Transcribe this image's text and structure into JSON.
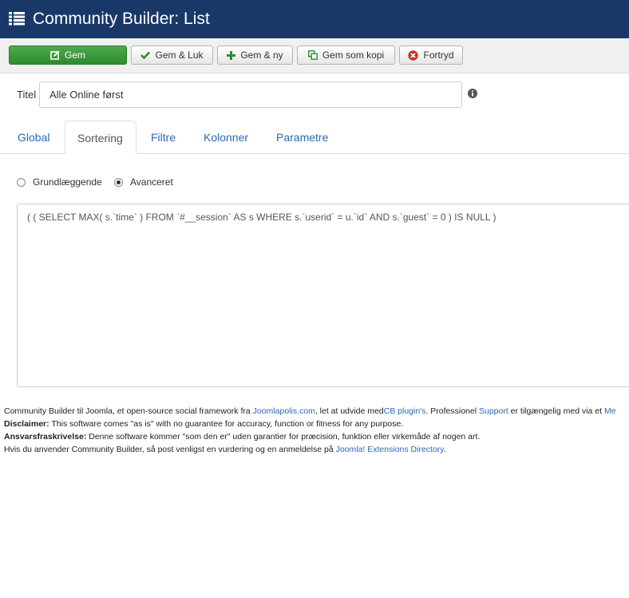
{
  "header": {
    "title": "Community Builder: List",
    "menu_icon": "list-icon"
  },
  "toolbar": {
    "save_label": "Gem",
    "save_close_label": "Gem & Luk",
    "save_new_label": "Gem & ny",
    "save_copy_label": "Gem som kopi",
    "cancel_label": "Fortryd",
    "colors": {
      "save_green": "#3a9a3a",
      "cancel_red": "#c0392b",
      "check_green": "#2f8a2f"
    }
  },
  "form": {
    "title_label": "Titel",
    "title_value": "Alle Online først"
  },
  "tabs": [
    {
      "label": "Global"
    },
    {
      "label": "Sortering",
      "active": true
    },
    {
      "label": "Filtre"
    },
    {
      "label": "Kolonner"
    },
    {
      "label": "Parametre"
    }
  ],
  "sort_mode": {
    "basic_label": "Grundlæggende",
    "advanced_label": "Avanceret",
    "selected": "Avanceret"
  },
  "advanced_query": "( ( SELECT MAX( s.`time` ) FROM `#__session` AS s WHERE s.`userid` = u.`id` AND s.`guest` = 0 ) IS NULL )",
  "footer": {
    "line1_pre": "Community Builder til Joomla, et open-source social framework fra ",
    "line1_link1": "Joomlapolis.com",
    "line1_mid": ", let at udvide med",
    "line1_link2": "CB plugin's",
    "line1_mid2": ". Professionel ",
    "line1_link3": "Support",
    "line1_post": " er tilgængelig med via et ",
    "line1_link4": "Me",
    "line2_bold": "Disclaimer:",
    "line2_text": " This software comes \"as is\" with no guarantee for accuracy, function or fitness for any purpose.",
    "line3_bold": "Ansvarsfraskrivelse:",
    "line3_text": " Denne software kommer \"som den er\" uden garantier for præcision, funktion eller virkemåde af nogen art.",
    "line4_pre": "Hvis du anvender Community Builder, så post venligst en vurdering og en anmeldelse på ",
    "line4_link": "Joomla! Extensions Directory",
    "line4_post": "."
  }
}
